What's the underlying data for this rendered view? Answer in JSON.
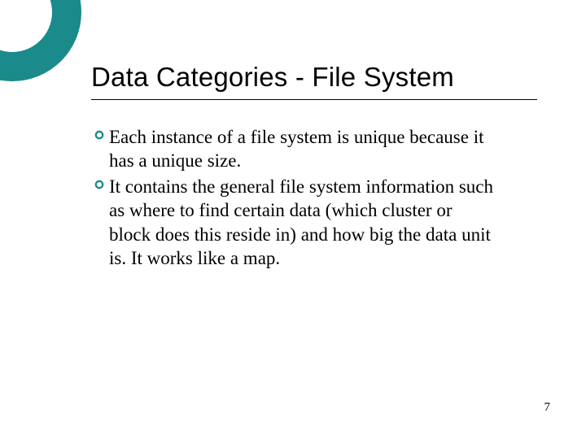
{
  "slide": {
    "title": "Data Categories - File System",
    "bullets": [
      "Each instance of a file system is unique because it has a unique size.",
      "It contains the general file system information such as where to find certain data (which cluster or block does this  reside in) and how big the data unit is. It works like a map."
    ],
    "page_number": "7"
  },
  "colors": {
    "accent": "#1a8a8a"
  }
}
